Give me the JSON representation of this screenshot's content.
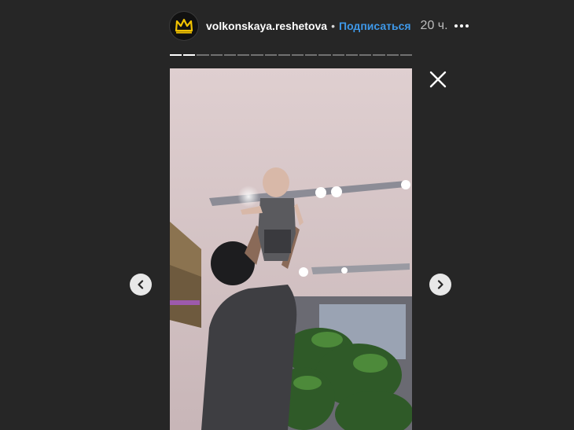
{
  "header": {
    "username": "volkonskaya.reshetova",
    "separator": "•",
    "subscribe_label": "Подписаться",
    "time": "20 ч.",
    "more_icon": "more-horizontal-icon",
    "avatar_icon": "crown-icon"
  },
  "progress": {
    "segments_total": 18,
    "segments_done": 2
  },
  "controls": {
    "close_icon": "close-icon",
    "prev_icon": "chevron-left-icon",
    "next_icon": "chevron-right-icon"
  },
  "colors": {
    "background": "#262626",
    "subscribe": "#3e98e8",
    "avatar_crown": "#f2c300"
  }
}
